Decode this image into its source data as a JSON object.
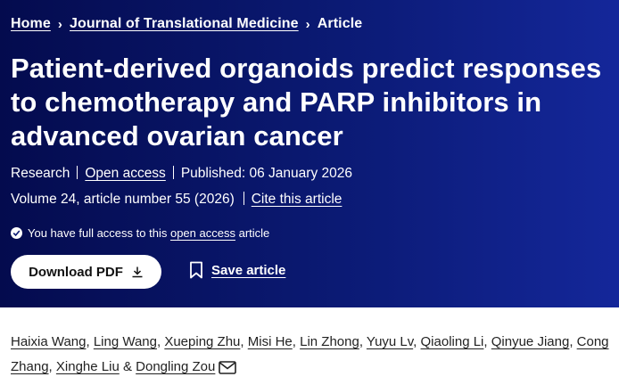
{
  "breadcrumb": {
    "home": "Home",
    "journal": "Journal of Translational Medicine",
    "current": "Article",
    "separator": "›"
  },
  "article": {
    "title": "Patient-derived organoids predict responses to chemotherapy and PARP inhibitors in advanced ovarian cancer",
    "type": "Research",
    "access": "Open access",
    "published": "Published: 06 January 2026",
    "volume": "Volume 24, article number 55 (2026)",
    "cite": "Cite this article"
  },
  "access_notice": {
    "prefix": "You have full access to this",
    "link": "open access",
    "suffix": "article"
  },
  "actions": {
    "download": "Download PDF",
    "save": "Save article"
  },
  "authors": [
    {
      "name": "Haixia Wang",
      "sep": ", "
    },
    {
      "name": "Ling Wang",
      "sep": ", "
    },
    {
      "name": "Xueping Zhu",
      "sep": ", "
    },
    {
      "name": "Misi He",
      "sep": ", "
    },
    {
      "name": "Lin Zhong",
      "sep": ", "
    },
    {
      "name": "Yuyu Lv",
      "sep": ", "
    },
    {
      "name": "Qiaoling Li",
      "sep": ", "
    },
    {
      "name": "Qinyue Jiang",
      "sep": ", "
    },
    {
      "name": "Cong Zhang",
      "sep": ", "
    },
    {
      "name": "Xinghe Liu",
      "sep": " & "
    },
    {
      "name": "Dongling Zou",
      "sep": ""
    }
  ],
  "icons": {
    "breadcrumb_separator": "chevron-right-icon",
    "access": "check-circle-icon",
    "download": "download-icon",
    "save": "bookmark-icon",
    "corresponding": "mail-icon"
  },
  "colors": {
    "hero_dark": "#040b4e",
    "hero_light": "#14279a",
    "text_on_hero": "#ffffff",
    "body_text": "#222222"
  }
}
